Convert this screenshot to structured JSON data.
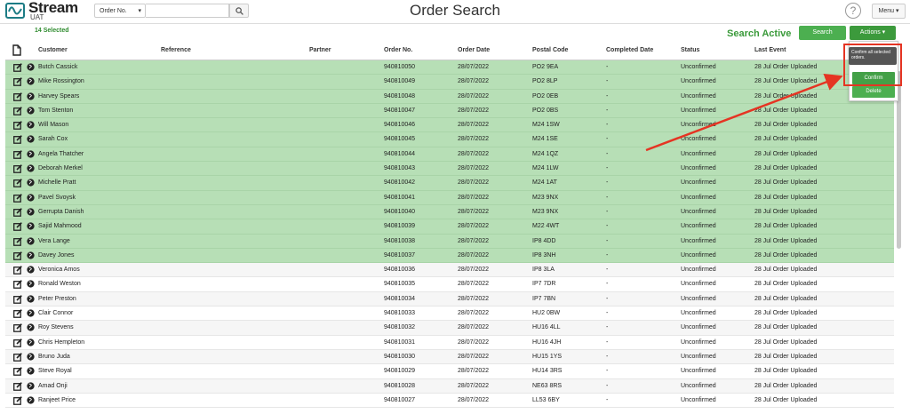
{
  "app": {
    "name": "Stream",
    "env": "UAT",
    "title": "Order Search"
  },
  "search": {
    "type_label": "Order No.",
    "placeholder": "",
    "value": ""
  },
  "header": {
    "help_label": "?",
    "menu_label": "Menu ▾"
  },
  "toolbar": {
    "selected_count": "14 Selected",
    "status": "Search Active",
    "search_label": "Search",
    "actions_label": "Actions ▾"
  },
  "actions_menu": {
    "tooltip": "Confirm all selected orders.",
    "confirm_label": "Confirm",
    "delete_label": "Delete"
  },
  "table": {
    "columns": [
      "Customer",
      "Reference",
      "Partner",
      "Order No.",
      "Order Date",
      "Postal Code",
      "Completed Date",
      "Status",
      "Last Event"
    ],
    "rows": [
      {
        "customer": "Butch Cassick",
        "reference": "",
        "partner": "",
        "order_no": "940810050",
        "order_date": "28/07/2022",
        "postal_code": "PO2 9EA",
        "completed": "-",
        "status": "Unconfirmed",
        "last_event": "28 Jul Order Uploaded",
        "selected": true
      },
      {
        "customer": "Mike Rossington",
        "reference": "",
        "partner": "",
        "order_no": "940810049",
        "order_date": "28/07/2022",
        "postal_code": "PO2 8LP",
        "completed": "-",
        "status": "Unconfirmed",
        "last_event": "28 Jul Order Uploaded",
        "selected": true
      },
      {
        "customer": "Harvey Spears",
        "reference": "",
        "partner": "",
        "order_no": "940810048",
        "order_date": "28/07/2022",
        "postal_code": "PO2 0EB",
        "completed": "-",
        "status": "Unconfirmed",
        "last_event": "28 Jul Order Uploaded",
        "selected": true
      },
      {
        "customer": "Tom Stenton",
        "reference": "",
        "partner": "",
        "order_no": "940810047",
        "order_date": "28/07/2022",
        "postal_code": "PO2 0BS",
        "completed": "-",
        "status": "Unconfirmed",
        "last_event": "28 Jul Order Uploaded",
        "selected": true
      },
      {
        "customer": "Will Mason",
        "reference": "",
        "partner": "",
        "order_no": "940810046",
        "order_date": "28/07/2022",
        "postal_code": "M24 1SW",
        "completed": "-",
        "status": "Unconfirmed",
        "last_event": "28 Jul Order Uploaded",
        "selected": true
      },
      {
        "customer": "Sarah Cox",
        "reference": "",
        "partner": "",
        "order_no": "940810045",
        "order_date": "28/07/2022",
        "postal_code": "M24 1SE",
        "completed": "-",
        "status": "Unconfirmed",
        "last_event": "28 Jul Order Uploaded",
        "selected": true
      },
      {
        "customer": "Angela Thatcher",
        "reference": "",
        "partner": "",
        "order_no": "940810044",
        "order_date": "28/07/2022",
        "postal_code": "M24 1QZ",
        "completed": "-",
        "status": "Unconfirmed",
        "last_event": "28 Jul Order Uploaded",
        "selected": true
      },
      {
        "customer": "Deborah Merkel",
        "reference": "",
        "partner": "",
        "order_no": "940810043",
        "order_date": "28/07/2022",
        "postal_code": "M24 1LW",
        "completed": "-",
        "status": "Unconfirmed",
        "last_event": "28 Jul Order Uploaded",
        "selected": true
      },
      {
        "customer": "Michelle Pratt",
        "reference": "",
        "partner": "",
        "order_no": "940810042",
        "order_date": "28/07/2022",
        "postal_code": "M24 1AT",
        "completed": "-",
        "status": "Unconfirmed",
        "last_event": "28 Jul Order Uploaded",
        "selected": true
      },
      {
        "customer": "Pavel Svoysk",
        "reference": "",
        "partner": "",
        "order_no": "940810041",
        "order_date": "28/07/2022",
        "postal_code": "M23 9NX",
        "completed": "-",
        "status": "Unconfirmed",
        "last_event": "28 Jul Order Uploaded",
        "selected": true
      },
      {
        "customer": "Gerrupta Danish",
        "reference": "",
        "partner": "",
        "order_no": "940810040",
        "order_date": "28/07/2022",
        "postal_code": "M23 9NX",
        "completed": "-",
        "status": "Unconfirmed",
        "last_event": "28 Jul Order Uploaded",
        "selected": true
      },
      {
        "customer": "Sajid Mahmood",
        "reference": "",
        "partner": "",
        "order_no": "940810039",
        "order_date": "28/07/2022",
        "postal_code": "M22 4WT",
        "completed": "-",
        "status": "Unconfirmed",
        "last_event": "28 Jul Order Uploaded",
        "selected": true
      },
      {
        "customer": "Vera Lange",
        "reference": "",
        "partner": "",
        "order_no": "940810038",
        "order_date": "28/07/2022",
        "postal_code": "IP8 4DD",
        "completed": "-",
        "status": "Unconfirmed",
        "last_event": "28 Jul Order Uploaded",
        "selected": true
      },
      {
        "customer": "Davey Jones",
        "reference": "",
        "partner": "",
        "order_no": "940810037",
        "order_date": "28/07/2022",
        "postal_code": "IP8 3NH",
        "completed": "-",
        "status": "Unconfirmed",
        "last_event": "28 Jul Order Uploaded",
        "selected": true
      },
      {
        "customer": "Veronica Amos",
        "reference": "",
        "partner": "",
        "order_no": "940810036",
        "order_date": "28/07/2022",
        "postal_code": "IP8 3LA",
        "completed": "-",
        "status": "Unconfirmed",
        "last_event": "28 Jul Order Uploaded",
        "selected": false
      },
      {
        "customer": "Ronald Weston",
        "reference": "",
        "partner": "",
        "order_no": "940810035",
        "order_date": "28/07/2022",
        "postal_code": "IP7 7DR",
        "completed": "-",
        "status": "Unconfirmed",
        "last_event": "28 Jul Order Uploaded",
        "selected": false
      },
      {
        "customer": "Peter Preston",
        "reference": "",
        "partner": "",
        "order_no": "940810034",
        "order_date": "28/07/2022",
        "postal_code": "IP7 7BN",
        "completed": "-",
        "status": "Unconfirmed",
        "last_event": "28 Jul Order Uploaded",
        "selected": false
      },
      {
        "customer": "Clair Connor",
        "reference": "",
        "partner": "",
        "order_no": "940810033",
        "order_date": "28/07/2022",
        "postal_code": "HU2 0BW",
        "completed": "-",
        "status": "Unconfirmed",
        "last_event": "28 Jul Order Uploaded",
        "selected": false
      },
      {
        "customer": "Roy Stevens",
        "reference": "",
        "partner": "",
        "order_no": "940810032",
        "order_date": "28/07/2022",
        "postal_code": "HU16 4LL",
        "completed": "-",
        "status": "Unconfirmed",
        "last_event": "28 Jul Order Uploaded",
        "selected": false
      },
      {
        "customer": "Chris Hempleton",
        "reference": "",
        "partner": "",
        "order_no": "940810031",
        "order_date": "28/07/2022",
        "postal_code": "HU16 4JH",
        "completed": "-",
        "status": "Unconfirmed",
        "last_event": "28 Jul Order Uploaded",
        "selected": false
      },
      {
        "customer": "Bruno Juda",
        "reference": "",
        "partner": "",
        "order_no": "940810030",
        "order_date": "28/07/2022",
        "postal_code": "HU15 1YS",
        "completed": "-",
        "status": "Unconfirmed",
        "last_event": "28 Jul Order Uploaded",
        "selected": false
      },
      {
        "customer": "Steve Royal",
        "reference": "",
        "partner": "",
        "order_no": "940810029",
        "order_date": "28/07/2022",
        "postal_code": "HU14 3RS",
        "completed": "-",
        "status": "Unconfirmed",
        "last_event": "28 Jul Order Uploaded",
        "selected": false
      },
      {
        "customer": "Amad Onji",
        "reference": "",
        "partner": "",
        "order_no": "940810028",
        "order_date": "28/07/2022",
        "postal_code": "NE63 8RS",
        "completed": "-",
        "status": "Unconfirmed",
        "last_event": "28 Jul Order Uploaded",
        "selected": false
      },
      {
        "customer": "Ranjeet Price",
        "reference": "",
        "partner": "",
        "order_no": "940810027",
        "order_date": "28/07/2022",
        "postal_code": "LL53 6BY",
        "completed": "-",
        "status": "Unconfirmed",
        "last_event": "28 Jul Order Uploaded",
        "selected": false
      }
    ]
  },
  "colors": {
    "selected_row": "#b7dfb6",
    "brand_green": "#4caf50",
    "status_green": "#3a9a3a",
    "annotation_red": "#e53423"
  },
  "icons": {
    "row_edit": "edit-icon",
    "row_globe": "globe-icon",
    "header_doc": "document-icon",
    "search": "magnifier-icon"
  }
}
